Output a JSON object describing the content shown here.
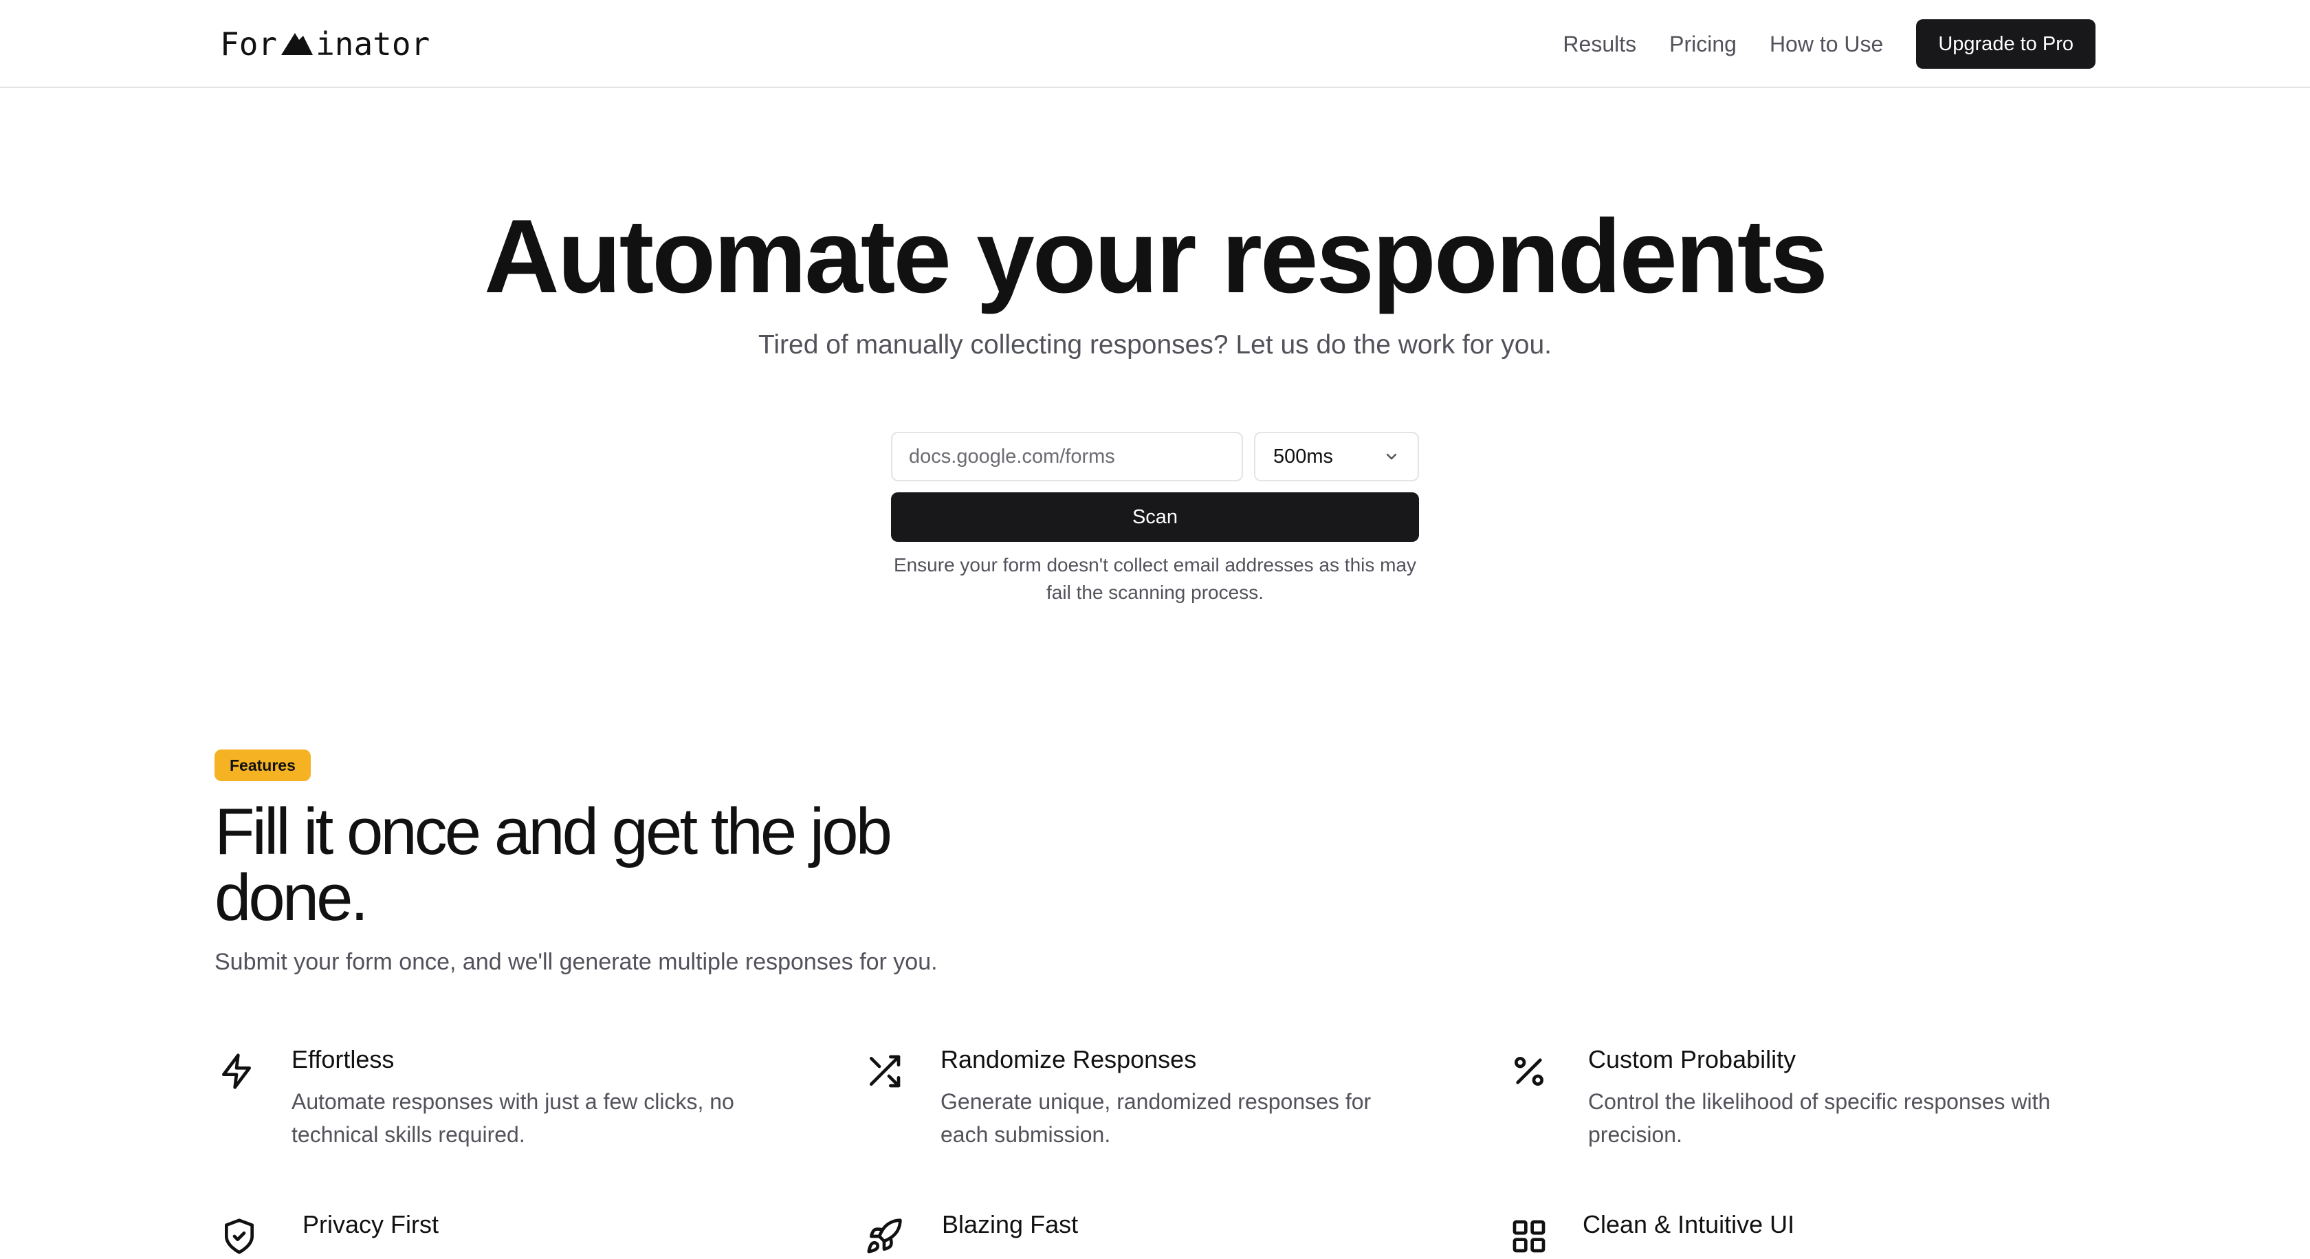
{
  "header": {
    "logo_left": "For",
    "logo_right": "inator",
    "nav": {
      "results": "Results",
      "pricing": "Pricing",
      "how_to_use": "How to Use"
    },
    "upgrade_label": "Upgrade to Pro"
  },
  "hero": {
    "title": "Automate your respondents",
    "subtitle": "Tired of manually collecting responses? Let us do the work for you.",
    "url_placeholder": "docs.google.com/forms",
    "delay_value": "500ms",
    "scan_label": "Scan",
    "note": "Ensure your form doesn't collect email addresses as this may fail the scanning process."
  },
  "features": {
    "badge": "Features",
    "title": "Fill it once and get the job done.",
    "subtitle": "Submit your form once, and we'll generate multiple responses for you.",
    "items": [
      {
        "icon": "lightning-icon",
        "title": "Effortless",
        "description": "Automate responses with just a few clicks, no technical skills required."
      },
      {
        "icon": "shuffle-icon",
        "title": "Randomize Responses",
        "description": "Generate unique, randomized responses for each submission."
      },
      {
        "icon": "percent-icon",
        "title": "Custom Probability",
        "description": "Control the likelihood of specific responses with precision."
      },
      {
        "icon": "shield-check-icon",
        "title": "Privacy First",
        "description": ""
      },
      {
        "icon": "rocket-icon",
        "title": "Blazing Fast",
        "description": ""
      },
      {
        "icon": "grid-icon",
        "title": "Clean & Intuitive UI",
        "description": ""
      }
    ]
  },
  "colors": {
    "primary_dark": "#18181b",
    "badge_yellow": "#f5b223",
    "muted_text": "#52525b",
    "border": "#e4e4e7"
  }
}
